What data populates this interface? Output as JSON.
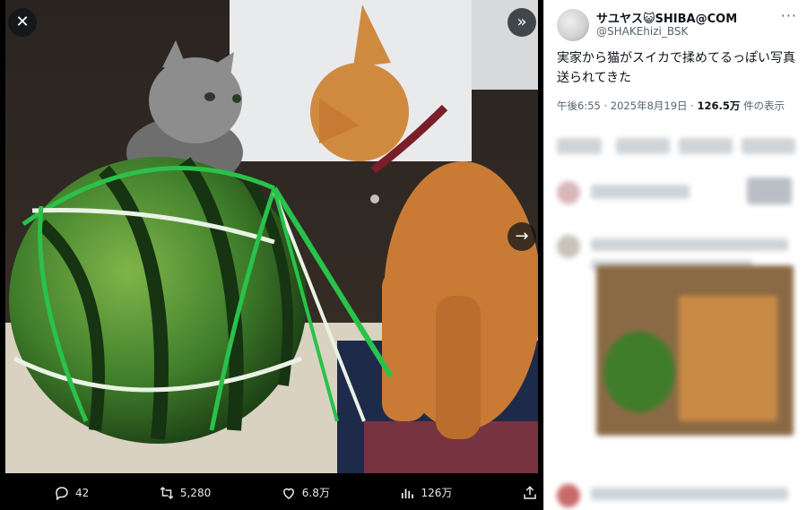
{
  "viewer": {
    "close_icon": "close-icon",
    "collapse_icon": "double-chevron-right-icon",
    "next_icon": "arrow-right-icon"
  },
  "actions": {
    "reply": {
      "icon": "reply-icon",
      "count": "42"
    },
    "repost": {
      "icon": "repost-icon",
      "count": "5,280"
    },
    "like": {
      "icon": "heart-icon",
      "count": "6.8万"
    },
    "views": {
      "icon": "views-icon",
      "count": "126万"
    },
    "share": {
      "icon": "share-icon"
    }
  },
  "post": {
    "author_name": "サユヤス😺SHIBA@COM",
    "author_handle": "@SHAKEhizi_BSK",
    "text": "実家から猫がスイカで揉めてるっぽい写真送られてきた",
    "time": "午後6:55",
    "date": "2025年8月19日",
    "views_count": "126.5万",
    "views_label": "件の表示",
    "separator": "·"
  }
}
